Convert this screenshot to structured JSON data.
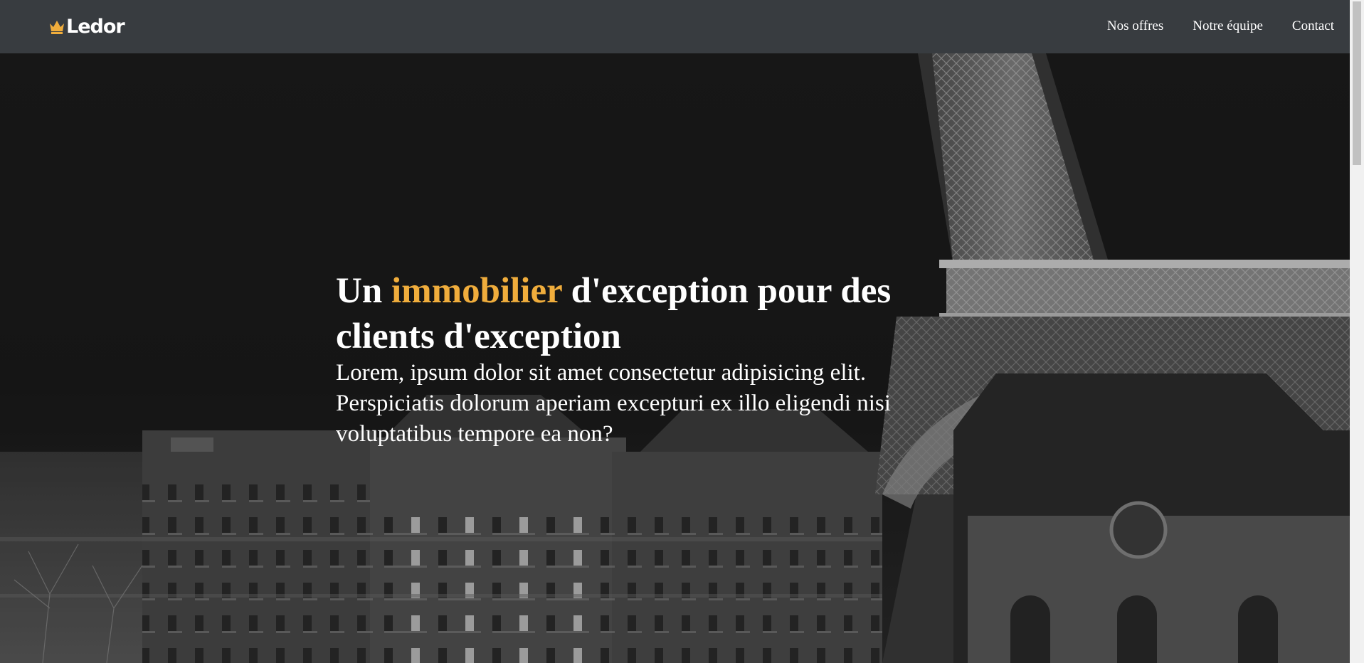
{
  "brand": {
    "name": "Ledor",
    "accent_color": "#f0ad3c",
    "logo_icon": "crown-icon"
  },
  "nav": {
    "items": [
      {
        "label": "Nos offres"
      },
      {
        "label": "Notre équipe"
      },
      {
        "label": "Contact"
      }
    ]
  },
  "hero": {
    "title_before": "Un ",
    "title_accent": "immobilier",
    "title_after": " d'exception pour des clients d'exception",
    "text": "Lorem, ipsum dolor sit amet consectetur adipisicing elit. Perspiciatis dolorum aperiam excepturi ex illo eligendi nisi voluptatibus tempore ea non?",
    "background": "black-and-white photo of Paris rooftops at night with the Eiffel Tower"
  },
  "colors": {
    "navbar": "#383c40",
    "text": "#ffffff"
  }
}
